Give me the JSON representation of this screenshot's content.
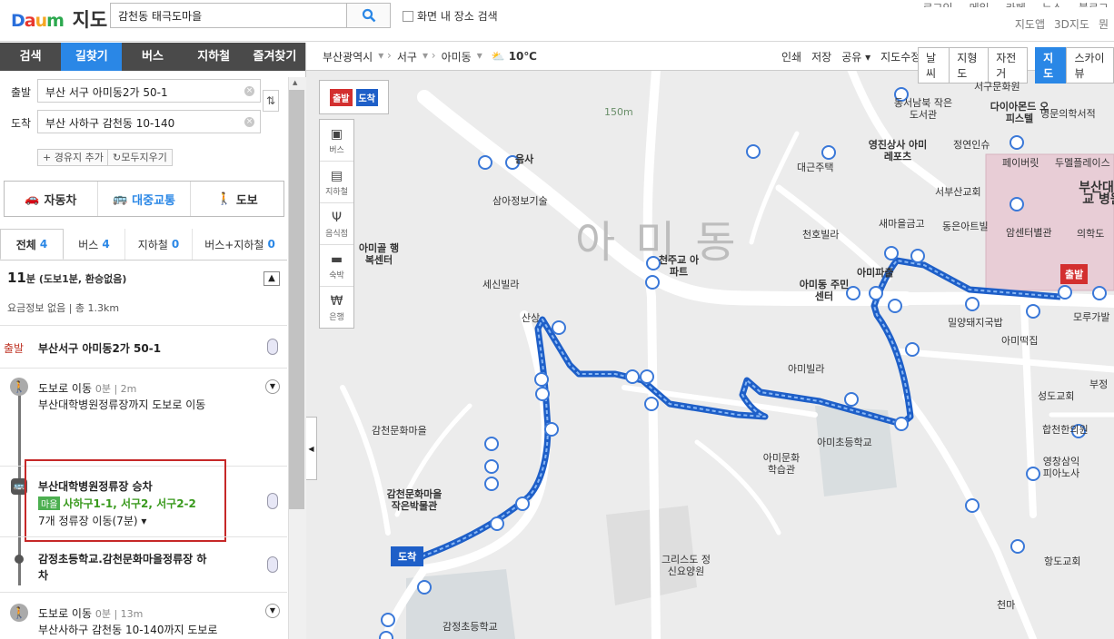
{
  "header": {
    "logo_daum": "Daum",
    "logo_jido": "지도",
    "search_value": "감천동 태극도마을",
    "area_search_label": "화면 내 장소 검색",
    "top_links_row1": [
      "로그인",
      "메일",
      "카페",
      "뉴스",
      "블로그"
    ],
    "top_links_row2": [
      "지도앱",
      "3D지도",
      "뭔"
    ]
  },
  "sidebar": {
    "nav": [
      "검색",
      "길찾기",
      "버스",
      "지하철",
      "즐겨찾기"
    ],
    "origin_label": "출발",
    "origin_value": "부산 서구 아미동2가 50-1",
    "dest_label": "도착",
    "dest_value": "부산 사하구 감천동 10-140",
    "add_waypoint": "+ 경유지 추가",
    "clear_all": "모두지우기",
    "modes": [
      "자동차",
      "대중교통",
      "도보"
    ],
    "subtabs": [
      {
        "label": "전체",
        "count": "4"
      },
      {
        "label": "버스",
        "count": "4"
      },
      {
        "label": "지하철",
        "count": "0"
      },
      {
        "label": "버스+지하철",
        "count": "0"
      }
    ],
    "summary_time": "11",
    "summary_unit": "분",
    "summary_detail": "(도보1분, 환승없음)",
    "fare_info": "요금정보 없음 | 총 1.3km",
    "steps": {
      "start_tag": "출발",
      "start_address": "부산서구 아미동2가 50-1",
      "walk1_title": "도보로 이동",
      "walk1_min": "0분",
      "walk1_dist": "2m",
      "walk1_desc": "부산대학병원정류장까지 도보로 이동",
      "board_title": "부산대학병원정류장 승차",
      "bus_tag": "마을",
      "bus_routes": "사하구1-1, 서구2, 서구2-2",
      "stops": "7개 정류장 이동(7분)",
      "alight_title": "감정초등학교.감천문화마을정류장 하",
      "alight_title2": "차",
      "walk2_title": "도보로 이동",
      "walk2_min": "0분",
      "walk2_dist": "13m",
      "walk2_desc": "부산사하구 감천동 10-140까지 도보로",
      "walk2_desc2": "이동"
    }
  },
  "map": {
    "breadcrumb": [
      "부산광역시",
      "서구",
      "아미동"
    ],
    "temperature": "10℃",
    "tools": [
      "인쇄",
      "저장",
      "공유",
      "지도수정"
    ],
    "overlays": [
      "날씨",
      "지형도",
      "자전거"
    ],
    "view_modes": [
      "지도",
      "스카이뷰"
    ],
    "side_tools": [
      "버스",
      "지하철",
      "음식점",
      "숙박",
      "은행"
    ],
    "origin_flag": "출발",
    "dest_flag": "도착",
    "area_name": "아미동",
    "scale": "150m",
    "labels": {
      "seoga": "서구문화원",
      "library": "동서남북 작은도서관",
      "diamond": "다이아몬드 오피스텔",
      "myeongmun": "명문의학서적",
      "yeongjin": "영진상사 아미레포츠",
      "jeongyeon": "정연인슈",
      "pharm": "페이버릿",
      "dumel": "두멜플레이스",
      "hospital": "부산대학교 병원",
      "eum": "음사",
      "daegeun": "대근주택",
      "seobu": "서부산교회",
      "saemaeul": "새마을금고",
      "dongeun": "동은아트빌",
      "amsenter": "암센터별관",
      "medical": "의학도",
      "samasheng": "삼아정보기술",
      "cheonho": "천호빌라",
      "amigol": "아미골 행복센터",
      "cheonjugyo": "천주교 아파트",
      "amipacheul": "아미파출",
      "sesin": "세신빌라",
      "amidong_center": "아미동 주민센터",
      "miryang": "밀양돼지국밥",
      "moru": "모루가발",
      "ami_tteok": "아미떡집",
      "sansang": "산상",
      "amivilla": "아미빌라",
      "seongdo": "성도교회",
      "bujeong": "부정",
      "hapcheon": "합천한의원",
      "gamcheon_munhwa": "감천문화마을",
      "ami_elem": "아미초등학교",
      "ami_hak": "아미문화 학습관",
      "yeongseong": "영창삼익 피아노사",
      "gamcheon_small": "감천문화마을 작은박물관",
      "christ": "그리스도 정신요양원",
      "hangdo": "항도교회",
      "gamjeong": "감정초등학교",
      "cheonma": "천마"
    }
  },
  "colors": {
    "accent": "#2a87e6",
    "route": "#3a78d8",
    "highlight": "#c62828",
    "origin_flag": "#d32f2f",
    "dest_flag": "#1e5fc8"
  }
}
